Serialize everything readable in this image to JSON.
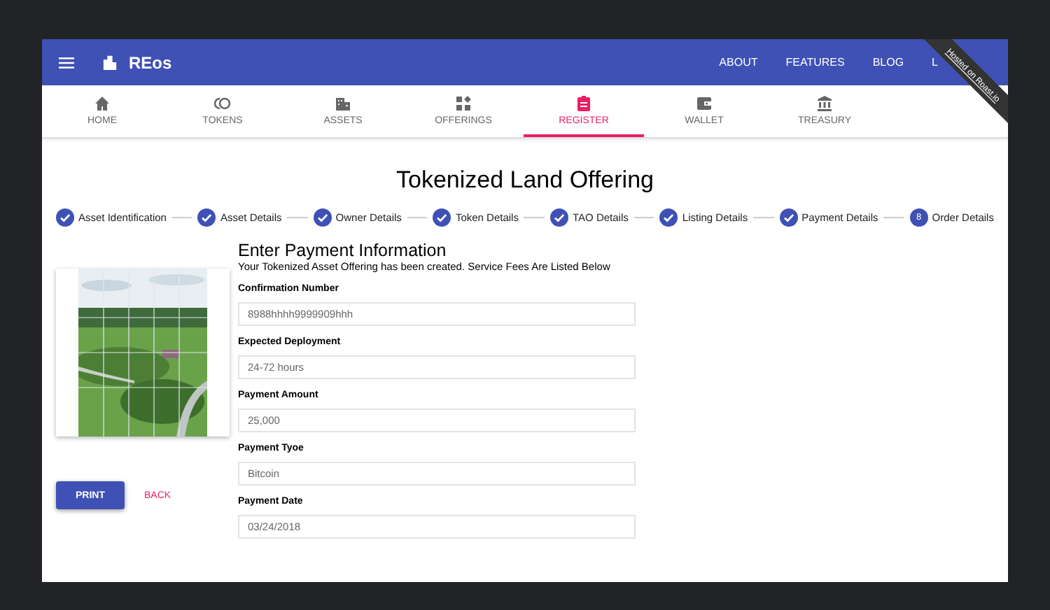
{
  "app_bar": {
    "title": "REos",
    "links": [
      {
        "label": "ABOUT"
      },
      {
        "label": "FEATURES"
      },
      {
        "label": "BLOG"
      },
      {
        "label": "L"
      }
    ]
  },
  "ribbon": {
    "text": "Hosted on Roast.io"
  },
  "tabs": [
    {
      "label": "HOME",
      "selected": false
    },
    {
      "label": "TOKENS",
      "selected": false
    },
    {
      "label": "ASSETS",
      "selected": false
    },
    {
      "label": "OFFERINGS",
      "selected": false
    },
    {
      "label": "REGISTER",
      "selected": true
    },
    {
      "label": "WALLET",
      "selected": false
    },
    {
      "label": "TREASURY",
      "selected": false
    }
  ],
  "page_title": "Tokenized Land Offering",
  "steps": [
    {
      "label": "Asset Identification",
      "done": true
    },
    {
      "label": "Asset Details",
      "done": true
    },
    {
      "label": "Owner Details",
      "done": true
    },
    {
      "label": "Token Details",
      "done": true
    },
    {
      "label": "TAO Details",
      "done": true
    },
    {
      "label": "Listing Details",
      "done": true
    },
    {
      "label": "Payment Details",
      "done": true
    },
    {
      "label": "Order Details",
      "done": false,
      "number": "8"
    }
  ],
  "buttons": [
    {
      "label": "PRINT",
      "kind": "raised"
    },
    {
      "label": "BACK",
      "kind": "flat"
    }
  ],
  "form": {
    "heading": "Enter Payment Information",
    "subtitle": "Your Tokenized Asset Offering has been created. Service Fees Are Listed Below",
    "fields": [
      {
        "label": "Confirmation Number",
        "value": "8988hhhh9999909hhh"
      },
      {
        "label": "Expected Deployment",
        "value": "24-72 hours"
      },
      {
        "label": "Payment Amount",
        "value": "25,000"
      },
      {
        "label": "Payment Tyoe",
        "value": "Bitcoin"
      },
      {
        "label": "Payment Date",
        "value": "03/24/2018"
      }
    ]
  }
}
